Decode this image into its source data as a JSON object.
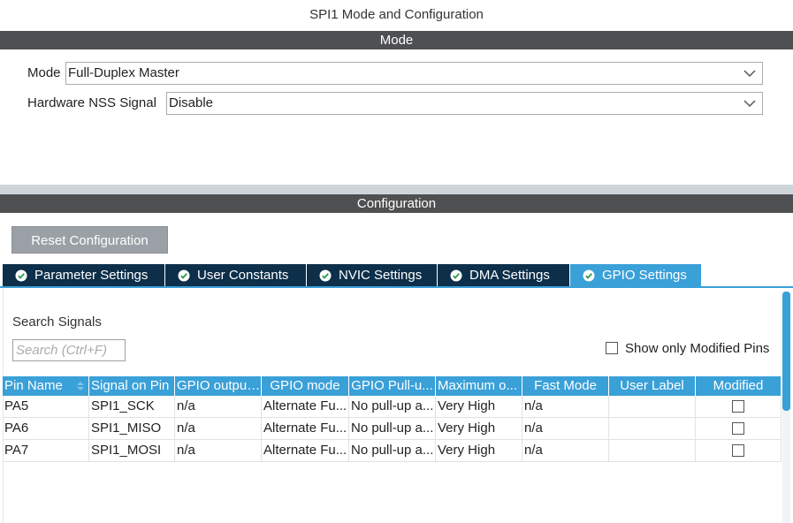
{
  "window": {
    "title": "SPI1 Mode and Configuration"
  },
  "sections": {
    "mode": "Mode",
    "configuration": "Configuration"
  },
  "mode_form": {
    "mode_label": "Mode",
    "mode_value": "Full-Duplex Master",
    "nss_label": "Hardware NSS Signal",
    "nss_value": "Disable"
  },
  "config": {
    "reset_label": "Reset Configuration",
    "tabs": [
      {
        "label": "Parameter Settings",
        "active": false
      },
      {
        "label": "User Constants",
        "active": false
      },
      {
        "label": "NVIC Settings",
        "active": false
      },
      {
        "label": "DMA Settings",
        "active": false
      },
      {
        "label": "GPIO Settings",
        "active": true
      }
    ]
  },
  "gpio": {
    "search_title": "Search Signals",
    "search_placeholder": "Search (Ctrl+F)",
    "show_modified_label": "Show only Modified Pins",
    "columns": [
      "Pin Name",
      "Signal on Pin",
      "GPIO output...",
      "GPIO mode",
      "GPIO Pull-u...",
      "Maximum o...",
      "Fast Mode",
      "User Label",
      "Modified"
    ],
    "rows": [
      [
        "PA5",
        "SPI1_SCK",
        "n/a",
        "Alternate Fu...",
        "No pull-up a...",
        "Very High",
        "n/a",
        "",
        ""
      ],
      [
        "PA6",
        "SPI1_MISO",
        "n/a",
        "Alternate Fu...",
        "No pull-up a...",
        "Very High",
        "n/a",
        "",
        ""
      ],
      [
        "PA7",
        "SPI1_MOSI",
        "n/a",
        "Alternate Fu...",
        "No pull-up a...",
        "Very High",
        "n/a",
        "",
        ""
      ]
    ]
  },
  "icons": {
    "tab": "check-circle-icon",
    "select": "chevron-down-icon",
    "sort": "sort-icon"
  },
  "colors": {
    "accent": "#3aa0d8",
    "dark_tab": "#0d2f4a",
    "section_bar": "#4f5052",
    "button": "#9aa0a6"
  }
}
